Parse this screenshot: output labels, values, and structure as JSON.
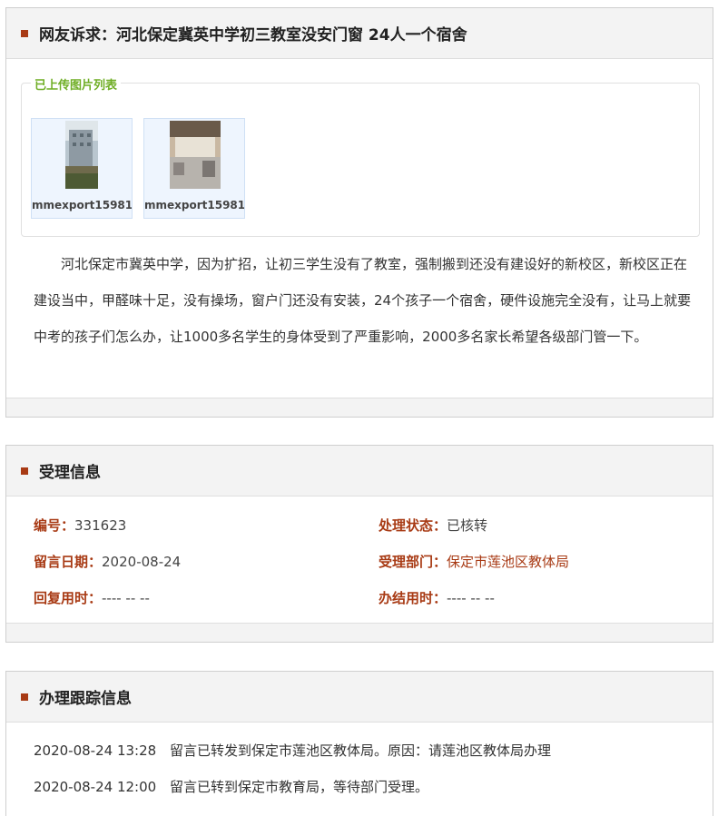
{
  "complaint": {
    "title": "网友诉求：河北保定冀英中学初三教室没安门窗 24人一个宿舍",
    "images_legend": "已上传图片列表",
    "images": [
      {
        "caption": "mmexport15981"
      },
      {
        "caption": "mmexport15981"
      }
    ],
    "body": "河北保定市冀英中学，因为扩招，让初三学生没有了教室，强制搬到还没有建设好的新校区，新校区正在建设当中，甲醛味十足，没有操场，窗户门还没有安装，24个孩子一个宿舍，硬件设施完全没有，让马上就要中考的孩子们怎么办，让1000多名学生的身体受到了严重影响，2000多名家长希望各级部门管一下。"
  },
  "acceptance": {
    "title": "受理信息",
    "id_label": "编号：",
    "id_value": "331623",
    "status_label": "处理状态：",
    "status_value": "已核转",
    "date_label": "留言日期：",
    "date_value": "2020-08-24",
    "dept_label": "受理部门：",
    "dept_value": "保定市莲池区教体局",
    "reply_time_label": "回复用时：",
    "reply_time_value": "---- -- --",
    "finish_time_label": "办结用时：",
    "finish_time_value": "---- -- --"
  },
  "tracking": {
    "title": "办理跟踪信息",
    "entries": [
      {
        "time": "2020-08-24 13:28",
        "text": "留言已转发到保定市莲池区教体局。原因：请莲池区教体局办理"
      },
      {
        "time": "2020-08-24 12:00",
        "text": "留言已转到保定市教育局，等待部门受理。"
      }
    ]
  },
  "colors": {
    "accent": "#a83a14",
    "legend_green": "#6fae25",
    "panel_head_bg": "#f3f3f3"
  }
}
